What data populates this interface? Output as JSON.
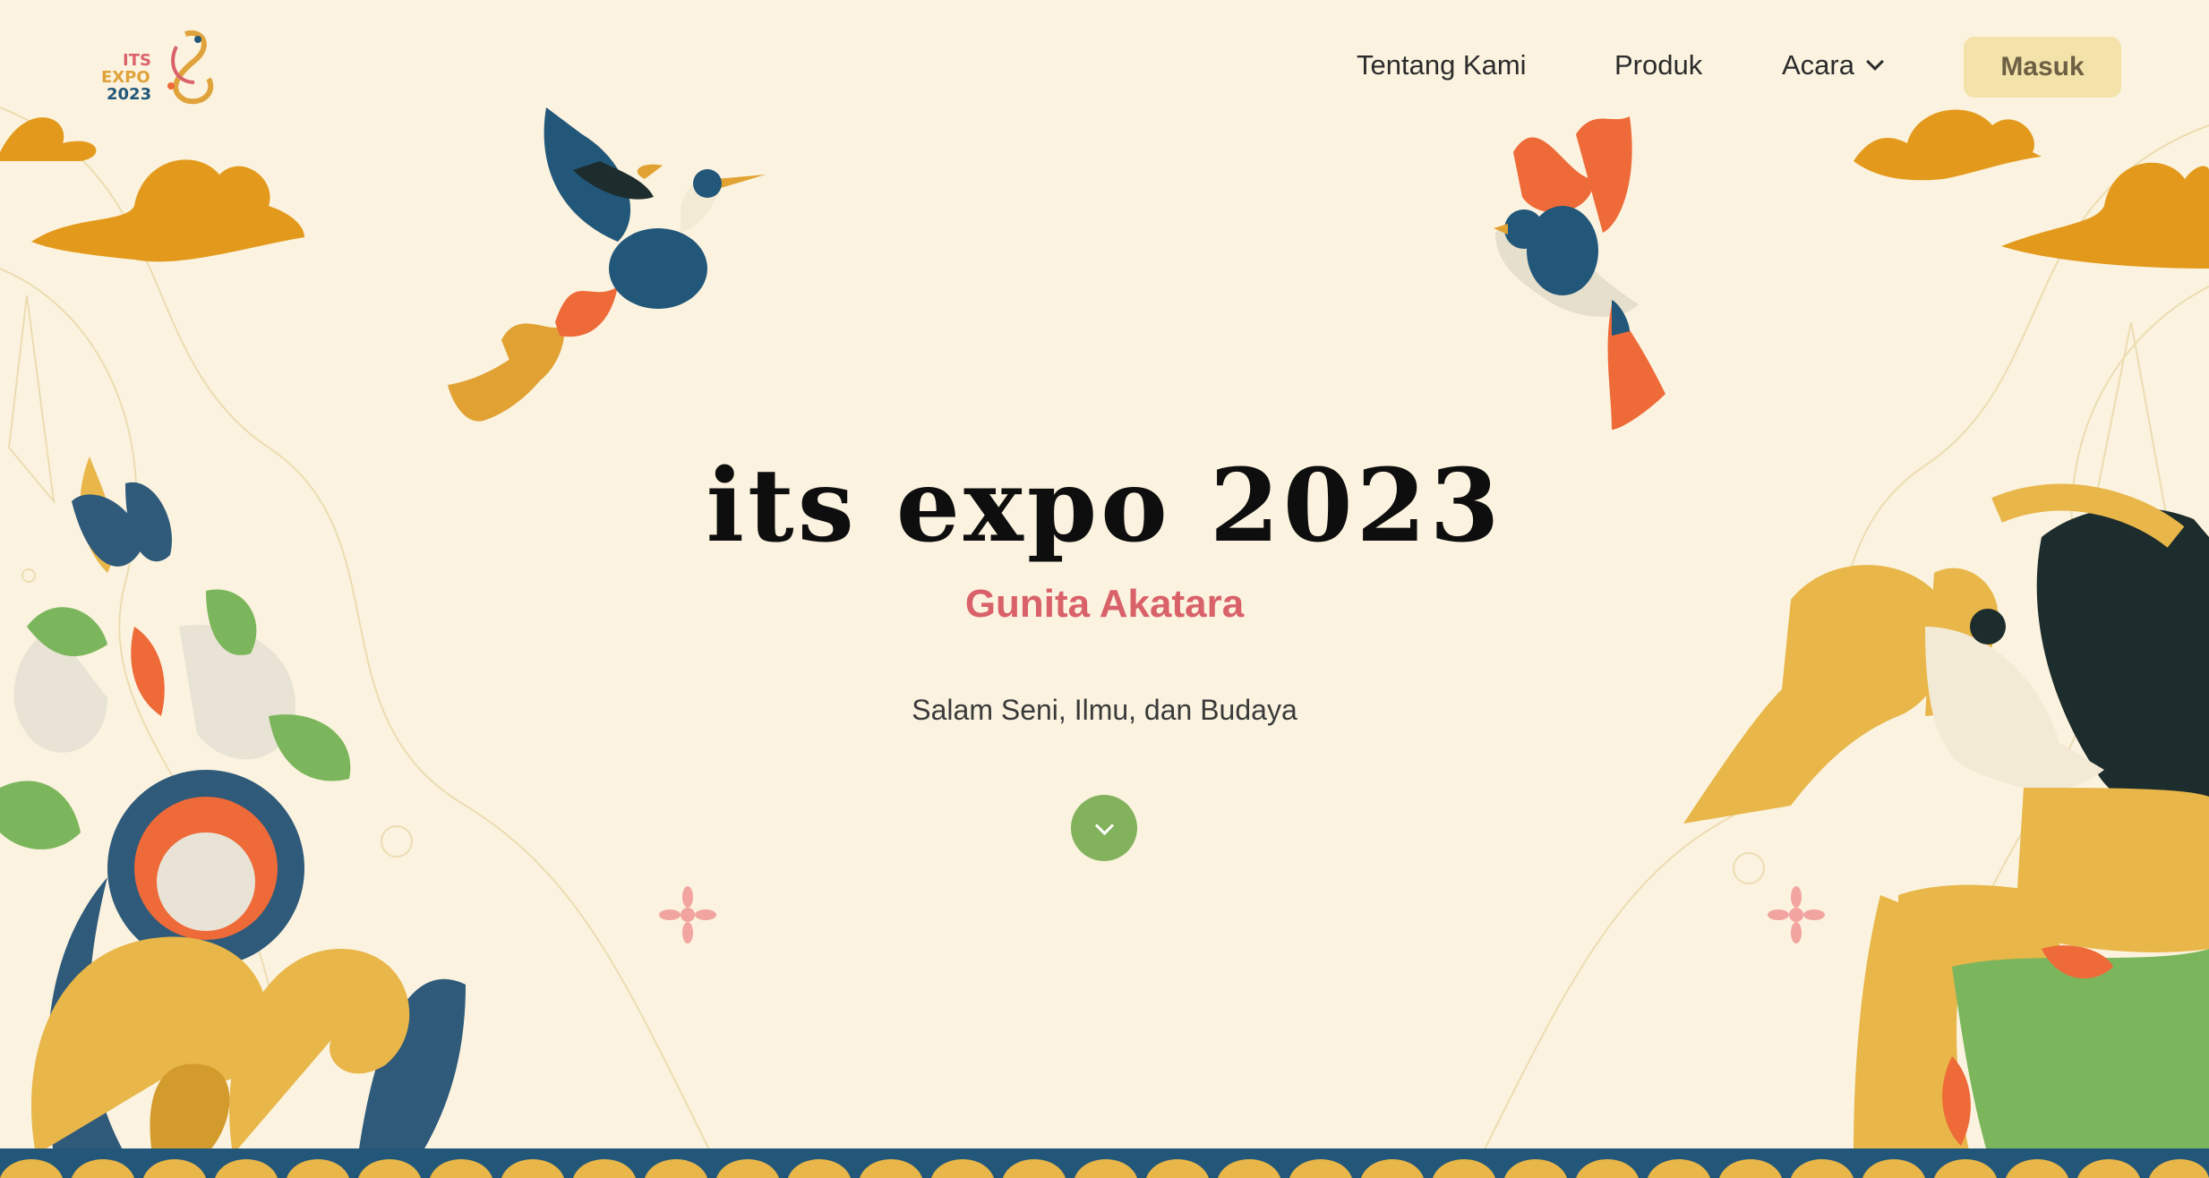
{
  "logo": {
    "line1": "ITS",
    "line2": "EXPO",
    "line3": "2023"
  },
  "nav": {
    "items": [
      {
        "label": "Tentang Kami"
      },
      {
        "label": "Produk"
      },
      {
        "label": "Acara",
        "icon": "chevron-down-icon"
      }
    ],
    "login_label": "Masuk"
  },
  "hero": {
    "title": "its expo 2023",
    "subtitle": "Gunita Akatara",
    "tagline": "Salam Seni, Ilmu, dan Budaya",
    "scroll_icon": "chevron-down-icon"
  },
  "colors": {
    "background": "#fbf3df",
    "accent_red": "#d9626a",
    "accent_green": "#82b25c",
    "gold": "#e0a23a",
    "blue": "#22577a",
    "orange": "#ee6a38",
    "login_bg": "#f3e2a9"
  }
}
